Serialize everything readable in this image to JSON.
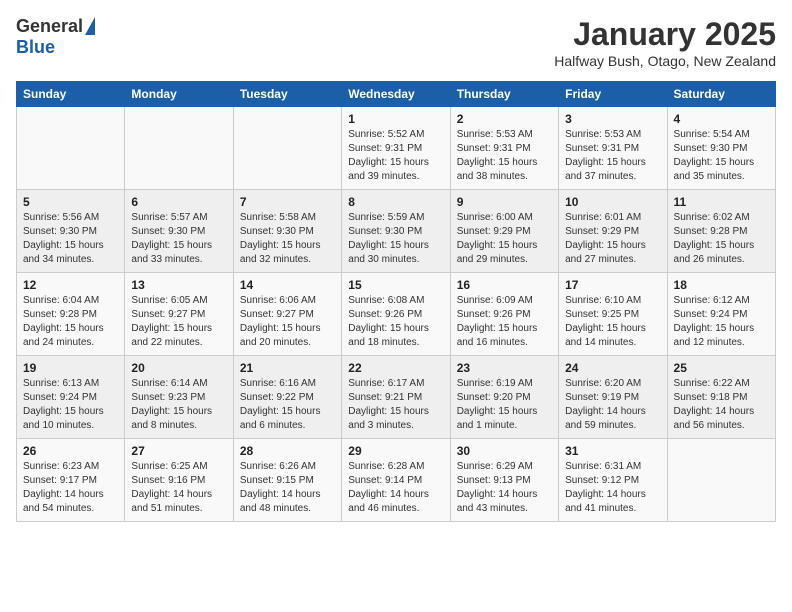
{
  "header": {
    "logo_general": "General",
    "logo_blue": "Blue",
    "month_title": "January 2025",
    "location": "Halfway Bush, Otago, New Zealand"
  },
  "days_of_week": [
    "Sunday",
    "Monday",
    "Tuesday",
    "Wednesday",
    "Thursday",
    "Friday",
    "Saturday"
  ],
  "weeks": [
    [
      {
        "day": "",
        "info": ""
      },
      {
        "day": "",
        "info": ""
      },
      {
        "day": "",
        "info": ""
      },
      {
        "day": "1",
        "info": "Sunrise: 5:52 AM\nSunset: 9:31 PM\nDaylight: 15 hours\nand 39 minutes."
      },
      {
        "day": "2",
        "info": "Sunrise: 5:53 AM\nSunset: 9:31 PM\nDaylight: 15 hours\nand 38 minutes."
      },
      {
        "day": "3",
        "info": "Sunrise: 5:53 AM\nSunset: 9:31 PM\nDaylight: 15 hours\nand 37 minutes."
      },
      {
        "day": "4",
        "info": "Sunrise: 5:54 AM\nSunset: 9:30 PM\nDaylight: 15 hours\nand 35 minutes."
      }
    ],
    [
      {
        "day": "5",
        "info": "Sunrise: 5:56 AM\nSunset: 9:30 PM\nDaylight: 15 hours\nand 34 minutes."
      },
      {
        "day": "6",
        "info": "Sunrise: 5:57 AM\nSunset: 9:30 PM\nDaylight: 15 hours\nand 33 minutes."
      },
      {
        "day": "7",
        "info": "Sunrise: 5:58 AM\nSunset: 9:30 PM\nDaylight: 15 hours\nand 32 minutes."
      },
      {
        "day": "8",
        "info": "Sunrise: 5:59 AM\nSunset: 9:30 PM\nDaylight: 15 hours\nand 30 minutes."
      },
      {
        "day": "9",
        "info": "Sunrise: 6:00 AM\nSunset: 9:29 PM\nDaylight: 15 hours\nand 29 minutes."
      },
      {
        "day": "10",
        "info": "Sunrise: 6:01 AM\nSunset: 9:29 PM\nDaylight: 15 hours\nand 27 minutes."
      },
      {
        "day": "11",
        "info": "Sunrise: 6:02 AM\nSunset: 9:28 PM\nDaylight: 15 hours\nand 26 minutes."
      }
    ],
    [
      {
        "day": "12",
        "info": "Sunrise: 6:04 AM\nSunset: 9:28 PM\nDaylight: 15 hours\nand 24 minutes."
      },
      {
        "day": "13",
        "info": "Sunrise: 6:05 AM\nSunset: 9:27 PM\nDaylight: 15 hours\nand 22 minutes."
      },
      {
        "day": "14",
        "info": "Sunrise: 6:06 AM\nSunset: 9:27 PM\nDaylight: 15 hours\nand 20 minutes."
      },
      {
        "day": "15",
        "info": "Sunrise: 6:08 AM\nSunset: 9:26 PM\nDaylight: 15 hours\nand 18 minutes."
      },
      {
        "day": "16",
        "info": "Sunrise: 6:09 AM\nSunset: 9:26 PM\nDaylight: 15 hours\nand 16 minutes."
      },
      {
        "day": "17",
        "info": "Sunrise: 6:10 AM\nSunset: 9:25 PM\nDaylight: 15 hours\nand 14 minutes."
      },
      {
        "day": "18",
        "info": "Sunrise: 6:12 AM\nSunset: 9:24 PM\nDaylight: 15 hours\nand 12 minutes."
      }
    ],
    [
      {
        "day": "19",
        "info": "Sunrise: 6:13 AM\nSunset: 9:24 PM\nDaylight: 15 hours\nand 10 minutes."
      },
      {
        "day": "20",
        "info": "Sunrise: 6:14 AM\nSunset: 9:23 PM\nDaylight: 15 hours\nand 8 minutes."
      },
      {
        "day": "21",
        "info": "Sunrise: 6:16 AM\nSunset: 9:22 PM\nDaylight: 15 hours\nand 6 minutes."
      },
      {
        "day": "22",
        "info": "Sunrise: 6:17 AM\nSunset: 9:21 PM\nDaylight: 15 hours\nand 3 minutes."
      },
      {
        "day": "23",
        "info": "Sunrise: 6:19 AM\nSunset: 9:20 PM\nDaylight: 15 hours\nand 1 minute."
      },
      {
        "day": "24",
        "info": "Sunrise: 6:20 AM\nSunset: 9:19 PM\nDaylight: 14 hours\nand 59 minutes."
      },
      {
        "day": "25",
        "info": "Sunrise: 6:22 AM\nSunset: 9:18 PM\nDaylight: 14 hours\nand 56 minutes."
      }
    ],
    [
      {
        "day": "26",
        "info": "Sunrise: 6:23 AM\nSunset: 9:17 PM\nDaylight: 14 hours\nand 54 minutes."
      },
      {
        "day": "27",
        "info": "Sunrise: 6:25 AM\nSunset: 9:16 PM\nDaylight: 14 hours\nand 51 minutes."
      },
      {
        "day": "28",
        "info": "Sunrise: 6:26 AM\nSunset: 9:15 PM\nDaylight: 14 hours\nand 48 minutes."
      },
      {
        "day": "29",
        "info": "Sunrise: 6:28 AM\nSunset: 9:14 PM\nDaylight: 14 hours\nand 46 minutes."
      },
      {
        "day": "30",
        "info": "Sunrise: 6:29 AM\nSunset: 9:13 PM\nDaylight: 14 hours\nand 43 minutes."
      },
      {
        "day": "31",
        "info": "Sunrise: 6:31 AM\nSunset: 9:12 PM\nDaylight: 14 hours\nand 41 minutes."
      },
      {
        "day": "",
        "info": ""
      }
    ]
  ]
}
